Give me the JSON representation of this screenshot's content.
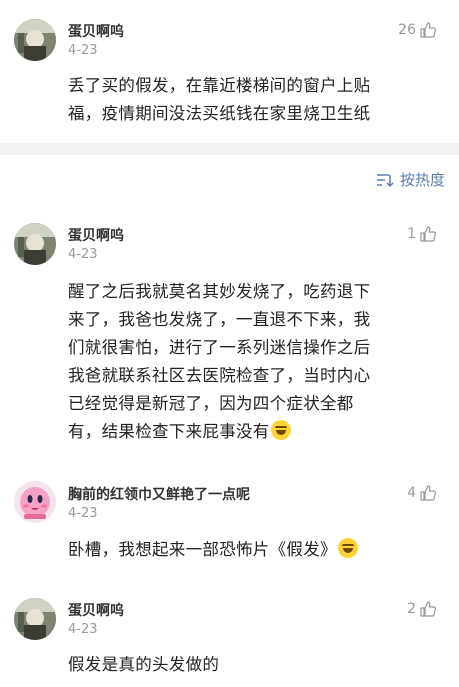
{
  "comments": [
    {
      "username": "蛋贝啊呜",
      "date": "4-23",
      "likes": "26",
      "avatar_icon": "user-avatar-icon",
      "lines": [
        "丢了买的假发，在靠近楼梯间的窗户上贴",
        "福，疫情期间没法买纸钱在家里烧卫生纸"
      ]
    },
    {
      "username": "蛋贝啊呜",
      "date": "4-23",
      "likes": "1",
      "avatar_icon": "user-avatar-icon",
      "lines": [
        "醒了之后我就莫名其妙发烧了，吃药退下",
        "来了，我爸也发烧了，一直退不下来，我",
        "们就很害怕，进行了一系列迷信操作之后",
        "我爸就联系社区去医院检查了，当时内心",
        "已经觉得是新冠了，因为四个症状全都",
        "有，结果检查下来屁事没有"
      ],
      "emoji": "laugh-cry-emoji"
    },
    {
      "username": "胸前的红领巾又鲜艳了一点呢",
      "date": "4-23",
      "likes": "4",
      "avatar_icon": "pink-character-avatar-icon",
      "lines": [
        "卧槽，我想起来一部恐怖片《假发》"
      ],
      "emoji": "laugh-cry-emoji"
    },
    {
      "username": "蛋贝啊呜",
      "date": "4-23",
      "likes": "2",
      "avatar_icon": "user-avatar-icon",
      "lines": [
        "假发是真的头发做的"
      ]
    }
  ],
  "sort": {
    "label": "按热度",
    "icon": "sort-icon"
  },
  "colors": {
    "accent": "#5a7fae",
    "muted": "#999999",
    "separator": "#f2f2f2"
  }
}
